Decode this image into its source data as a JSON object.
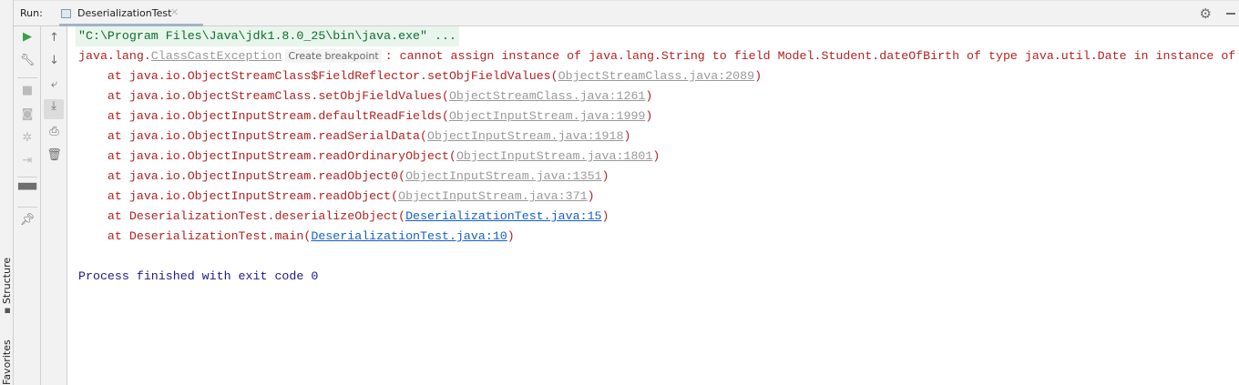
{
  "run_label": "Run:",
  "tab": {
    "title": "DeserializationTest"
  },
  "side_labels": {
    "structure": "Structure",
    "favorites": "Favorites"
  },
  "console": {
    "command": "\"C:\\Program Files\\Java\\jdk1.8.0_25\\bin\\java.exe\" ...",
    "exception_prefix": "java.lang.",
    "exception_class": "ClassCastException",
    "breakpoint_hint": "Create breakpoint",
    "exception_message": ": cannot assign instance of java.lang.String to field Model.Student.dateOfBirth of type java.util.Date in instance of",
    "stack": [
      {
        "text": "    at java.io.ObjectStreamClass$FieldReflector.setObjFieldValues(",
        "link": "ObjectStreamClass.java:2089",
        "end": ")",
        "user": false
      },
      {
        "text": "    at java.io.ObjectStreamClass.setObjFieldValues(",
        "link": "ObjectStreamClass.java:1261",
        "end": ")",
        "user": false
      },
      {
        "text": "    at java.io.ObjectInputStream.defaultReadFields(",
        "link": "ObjectInputStream.java:1999",
        "end": ")",
        "user": false
      },
      {
        "text": "    at java.io.ObjectInputStream.readSerialData(",
        "link": "ObjectInputStream.java:1918",
        "end": ")",
        "user": false
      },
      {
        "text": "    at java.io.ObjectInputStream.readOrdinaryObject(",
        "link": "ObjectInputStream.java:1801",
        "end": ")",
        "user": false
      },
      {
        "text": "    at java.io.ObjectInputStream.readObject0(",
        "link": "ObjectInputStream.java:1351",
        "end": ")",
        "user": false
      },
      {
        "text": "    at java.io.ObjectInputStream.readObject(",
        "link": "ObjectInputStream.java:371",
        "end": ")",
        "user": false
      },
      {
        "text": "    at DeserializationTest.deserializeObject(",
        "link": "DeserializationTest.java:15",
        "end": ")",
        "user": true
      },
      {
        "text": "    at DeserializationTest.main(",
        "link": "DeserializationTest.java:10",
        "end": ")",
        "user": true
      }
    ],
    "finished": "Process finished with exit code 0"
  },
  "colors": {
    "error": "#b22222",
    "run_green": "#3d9f4a",
    "link_blue": "#1560c8"
  }
}
